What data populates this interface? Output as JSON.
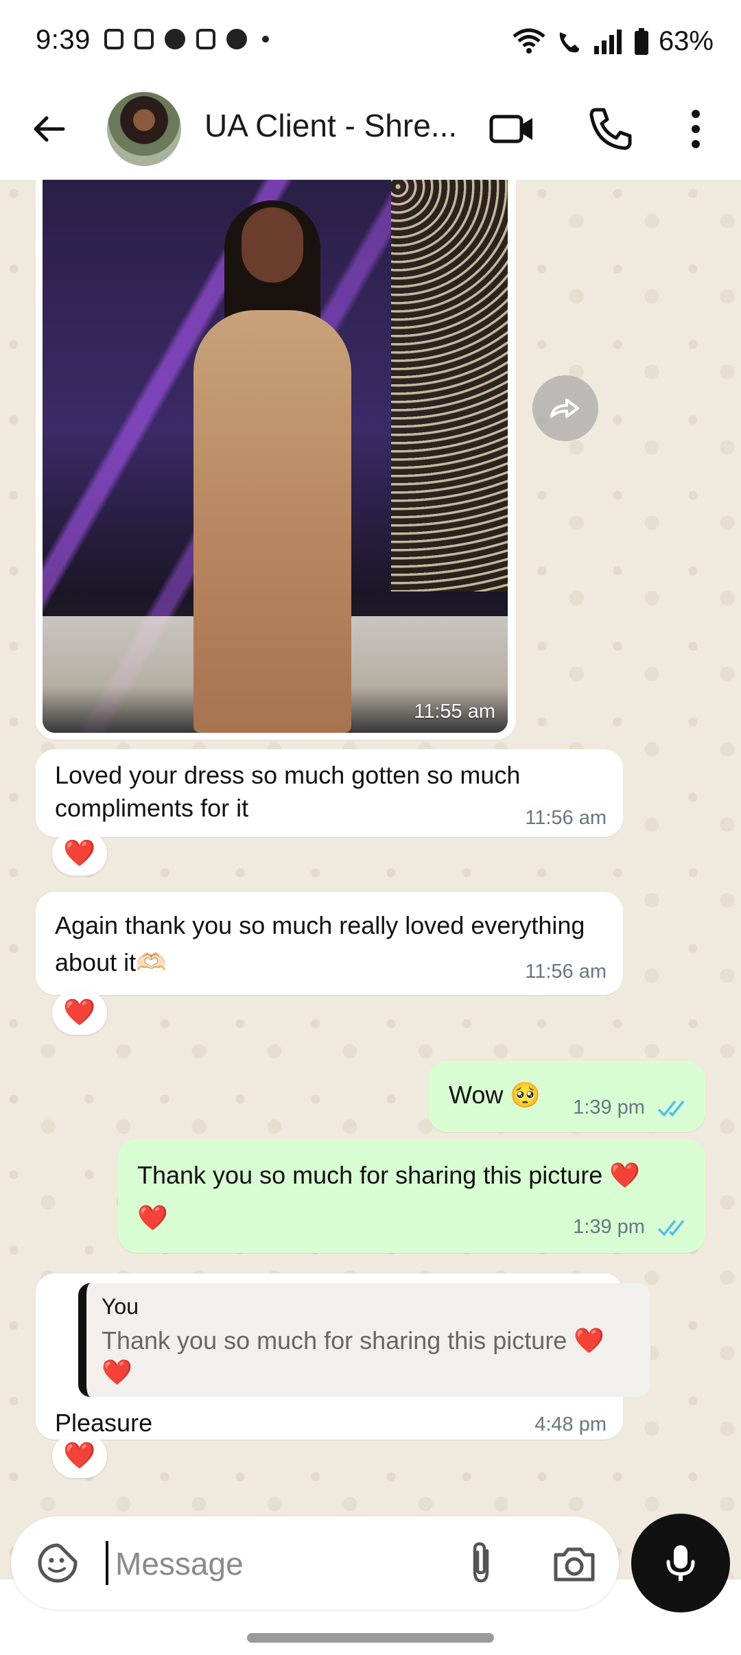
{
  "status_bar": {
    "time": "9:39",
    "battery": "63%",
    "icons": [
      "instagram-icon",
      "notification-icon",
      "pinterest-icon",
      "notification-icon",
      "pinterest-icon",
      "dot-icon",
      "wifi-icon",
      "wifi-calling-icon",
      "signal-icon",
      "battery-icon"
    ]
  },
  "header": {
    "contact_name": "UA Client - Shre...",
    "icons": [
      "back-arrow-icon",
      "avatar",
      "video-call-icon",
      "voice-call-icon",
      "more-options-icon"
    ]
  },
  "messages": [
    {
      "type": "image",
      "direction": "in",
      "time": "11:55 am"
    },
    {
      "type": "text",
      "direction": "in",
      "text": "Loved your dress so much gotten so much compliments for it",
      "time": "11:56 am",
      "reaction": "❤️"
    },
    {
      "type": "text",
      "direction": "in",
      "text": "Again thank you so much really loved everything about it🫶🏻",
      "time": "11:56 am",
      "reaction": "❤️"
    },
    {
      "type": "text",
      "direction": "out",
      "text": "Wow 🥺",
      "time": "1:39 pm",
      "status": "read"
    },
    {
      "type": "text",
      "direction": "out",
      "text": "Thank you so much for sharing this picture ❤️ ❤️",
      "time": "1:39 pm",
      "status": "read"
    },
    {
      "type": "text",
      "direction": "in",
      "quote": {
        "author": "You",
        "text": "Thank you so much for sharing this picture ❤️ ❤️"
      },
      "text": "Pleasure",
      "time": "4:48 pm",
      "reaction": "❤️"
    }
  ],
  "composer": {
    "placeholder": "Message"
  },
  "colors": {
    "chat_bg": "#efe9de",
    "outgoing_bubble": "#d9fdd3",
    "incoming_bubble": "#ffffff",
    "read_ticks": "#53bdeb",
    "mic_button": "#111111"
  }
}
